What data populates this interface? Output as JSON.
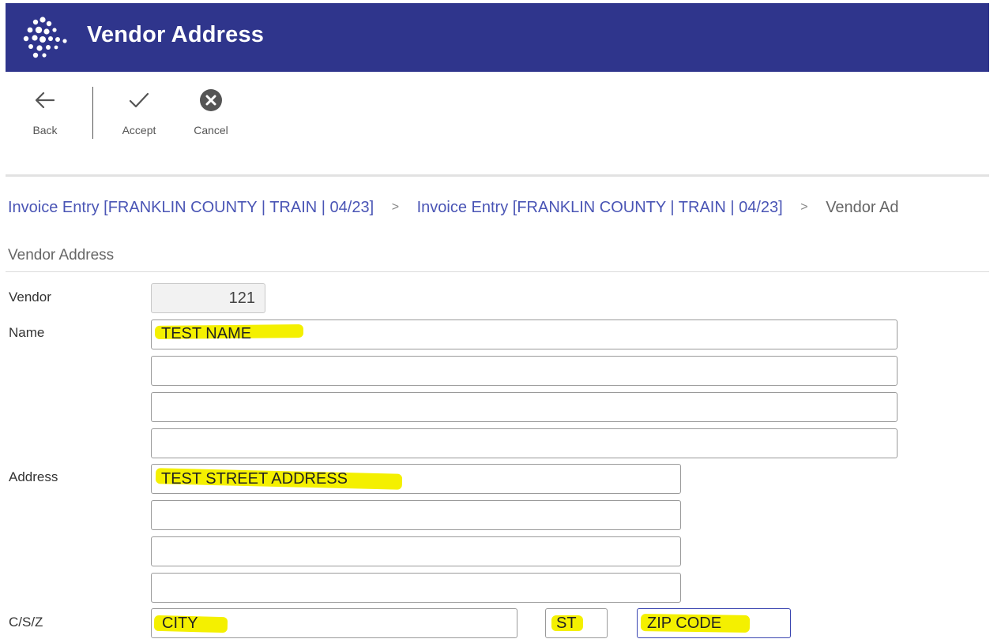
{
  "window": {
    "title": "Vendor Address",
    "logo_icon": "dot-cluster-logo",
    "brand_color": "#2f358c"
  },
  "toolbar": {
    "back_label": "Back",
    "accept_label": "Accept",
    "cancel_label": "Cancel"
  },
  "breadcrumb": {
    "items": [
      "Invoice Entry [FRANKLIN COUNTY | TRAIN | 04/23]",
      "Invoice Entry [FRANKLIN COUNTY | TRAIN | 04/23]"
    ],
    "current": "Vendor Ad",
    "separator": ">"
  },
  "form": {
    "section_title": "Vendor Address",
    "vendor_label": "Vendor",
    "vendor_value": "121",
    "name_label": "Name",
    "name_lines": [
      "TEST NAME",
      "",
      "",
      ""
    ],
    "address_label": "Address",
    "address_lines": [
      "TEST STREET ADDRESS",
      "",
      "",
      ""
    ],
    "csz_label": "C/S/Z",
    "city": "CITY",
    "state": "ST",
    "zip": "ZIP CODE"
  },
  "highlight_color": "#f4f000"
}
